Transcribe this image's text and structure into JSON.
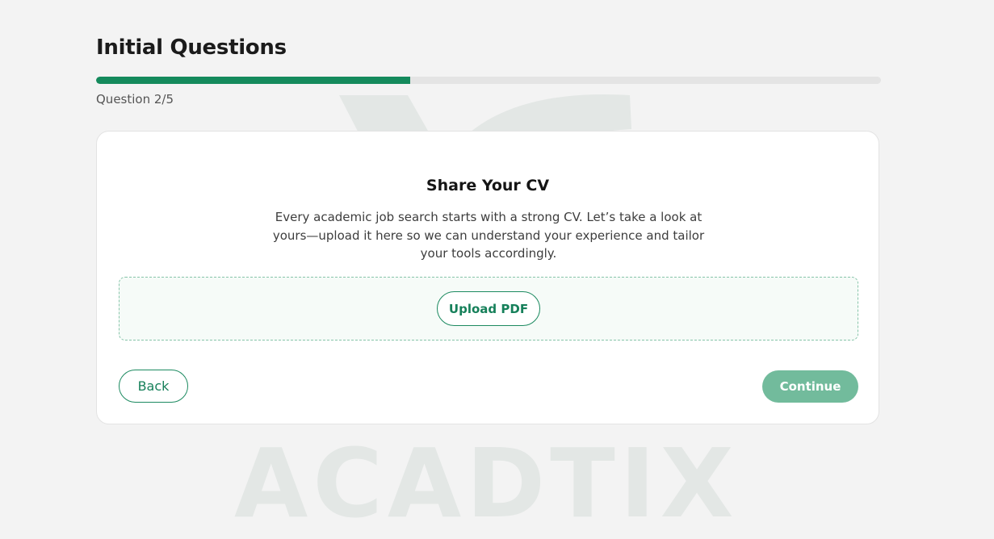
{
  "header": {
    "title": "Initial Questions",
    "progress_label": "Question 2/5",
    "progress_fraction": 0.4,
    "progress_color": "#148a5c",
    "track_color": "#e4e4e4"
  },
  "watermark": {
    "text": "ACADTIX"
  },
  "card": {
    "title": "Share Your CV",
    "description": "Every academic job search starts with a strong CV. Let’s take a look at yours—upload it here so we can understand your experience and tailor your tools accordingly.",
    "upload_label": "Upload PDF",
    "back_label": "Back",
    "continue_label": "Continue"
  },
  "colors": {
    "background": "#f3f3f3",
    "accent": "#148a5c",
    "continue_disabled": "#72bb9c",
    "dropzone_bg": "#f6fbf8"
  }
}
